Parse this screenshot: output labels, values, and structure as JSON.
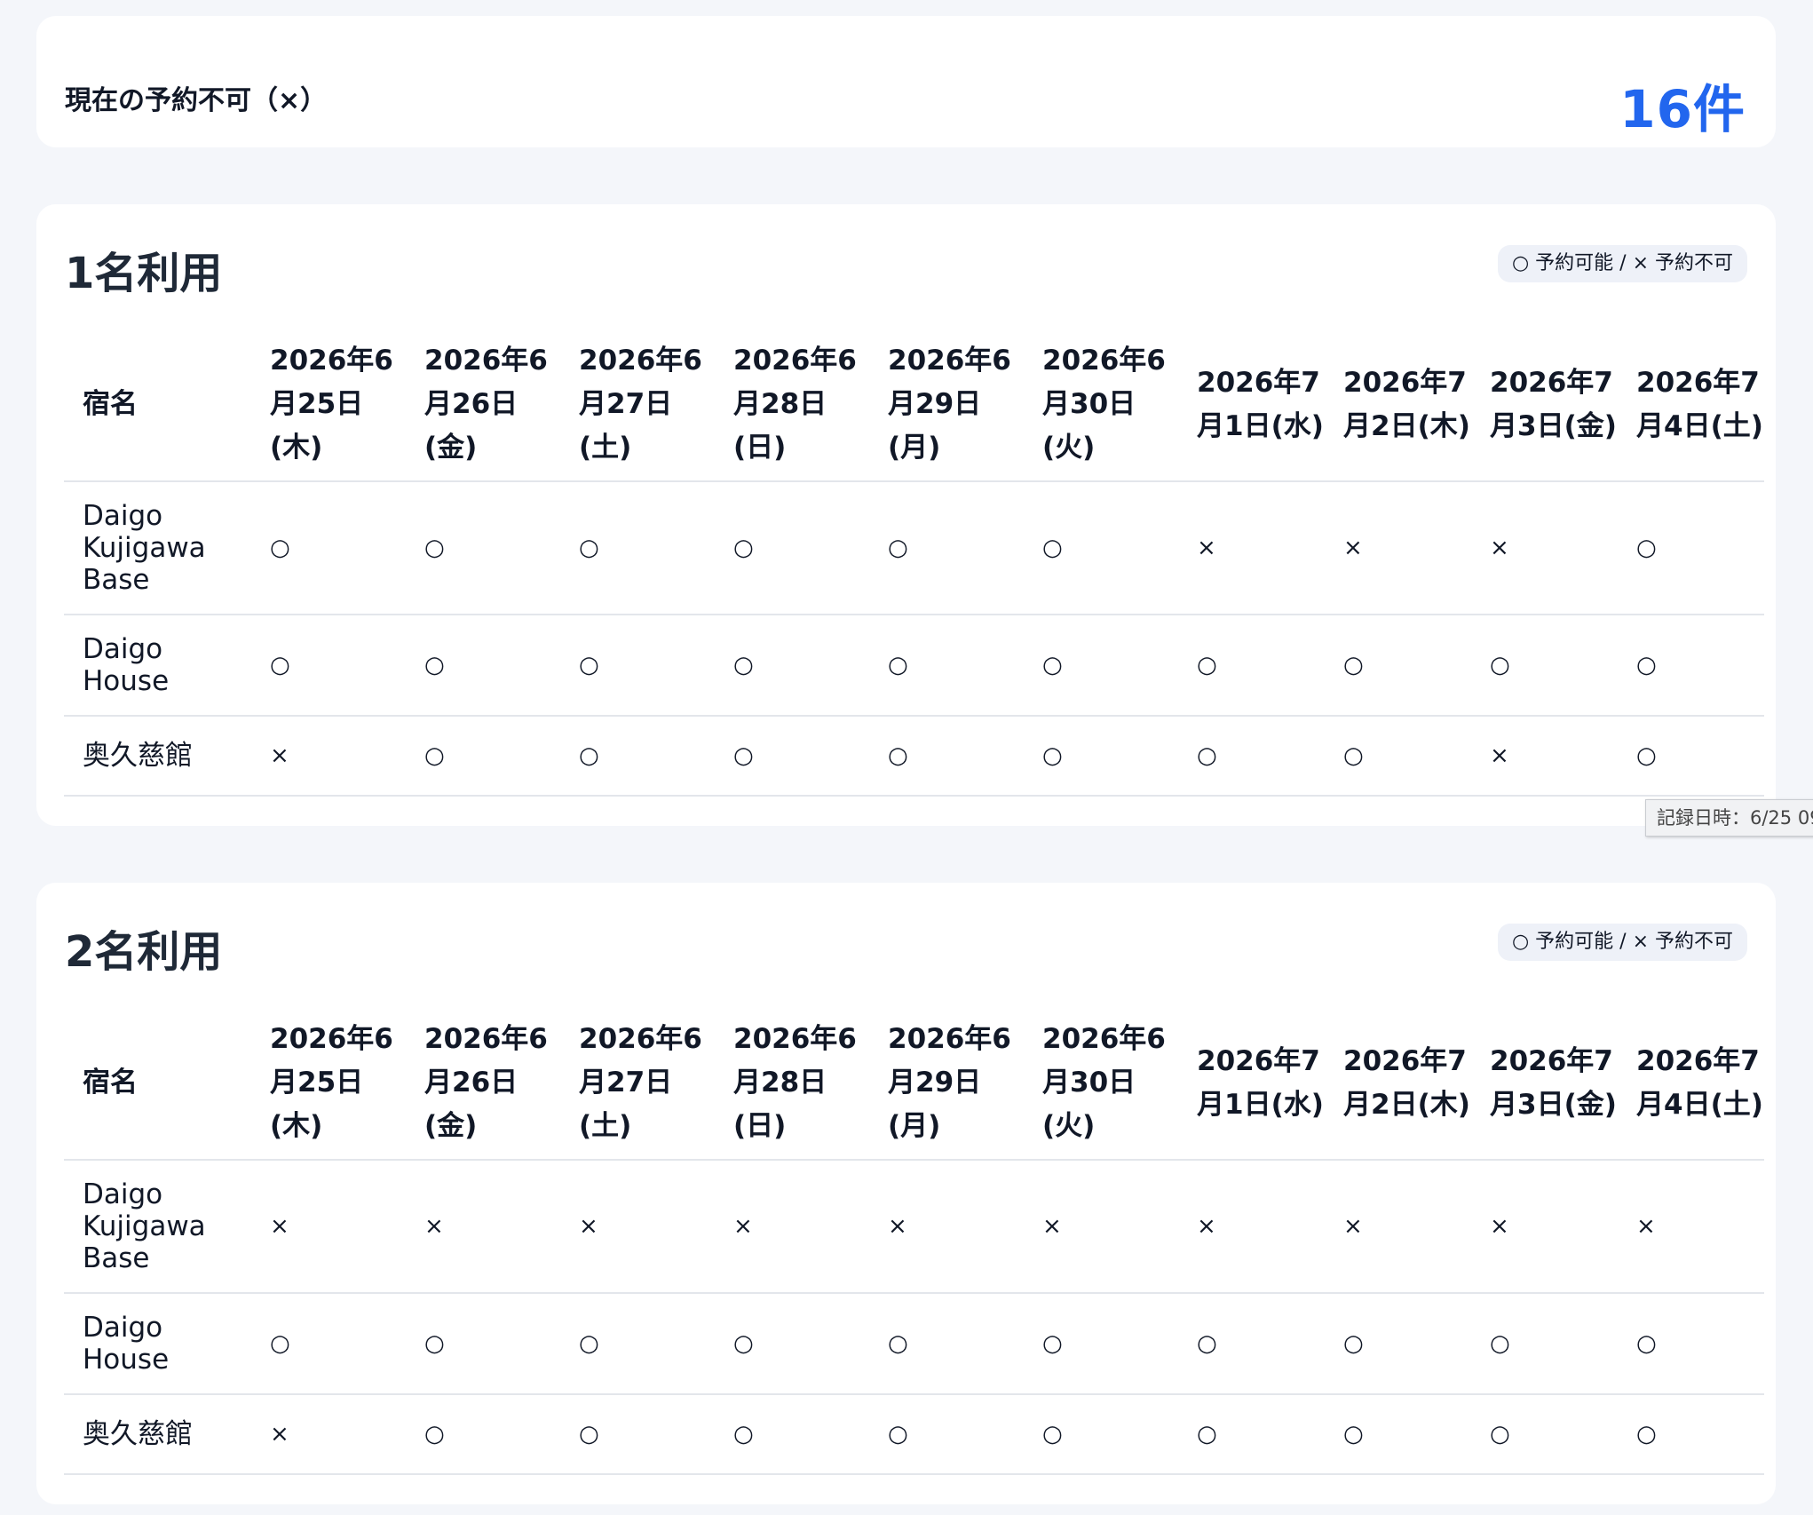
{
  "summary": {
    "label": "現在の予約不可（×）",
    "count": "16件"
  },
  "legend": "○ 予約可能 / × 予約不可",
  "tooltip": "記録日時：6/25 09",
  "sections": [
    {
      "title": "1名利用",
      "header": {
        "name_col": "宿名",
        "dates": [
          "2026年6月25日(木)",
          "2026年6月26日(金)",
          "2026年6月27日(土)",
          "2026年6月28日(日)",
          "2026年6月29日(月)",
          "2026年6月30日(火)",
          "2026年7月1日(水)",
          "2026年7月2日(木)",
          "2026年7月3日(金)",
          "2026年7月4日(土)"
        ]
      },
      "rows": [
        {
          "name": "Daigo Kujigawa Base",
          "cells": [
            "○",
            "○",
            "○",
            "○",
            "○",
            "○",
            "×",
            "×",
            "×",
            "○"
          ]
        },
        {
          "name": "Daigo House",
          "cells": [
            "○",
            "○",
            "○",
            "○",
            "○",
            "○",
            "○",
            "○",
            "○",
            "○"
          ]
        },
        {
          "name": "奥久慈館",
          "cells": [
            "×",
            "○",
            "○",
            "○",
            "○",
            "○",
            "○",
            "○",
            "×",
            "○"
          ]
        }
      ]
    },
    {
      "title": "2名利用",
      "header": {
        "name_col": "宿名",
        "dates": [
          "2026年6月25日(木)",
          "2026年6月26日(金)",
          "2026年6月27日(土)",
          "2026年6月28日(日)",
          "2026年6月29日(月)",
          "2026年6月30日(火)",
          "2026年7月1日(水)",
          "2026年7月2日(木)",
          "2026年7月3日(金)",
          "2026年7月4日(土)"
        ]
      },
      "rows": [
        {
          "name": "Daigo Kujigawa Base",
          "cells": [
            "×",
            "×",
            "×",
            "×",
            "×",
            "×",
            "×",
            "×",
            "×",
            "×"
          ]
        },
        {
          "name": "Daigo House",
          "cells": [
            "○",
            "○",
            "○",
            "○",
            "○",
            "○",
            "○",
            "○",
            "○",
            "○"
          ]
        },
        {
          "name": "奥久慈館",
          "cells": [
            "×",
            "○",
            "○",
            "○",
            "○",
            "○",
            "○",
            "○",
            "○",
            "○"
          ]
        }
      ]
    }
  ]
}
